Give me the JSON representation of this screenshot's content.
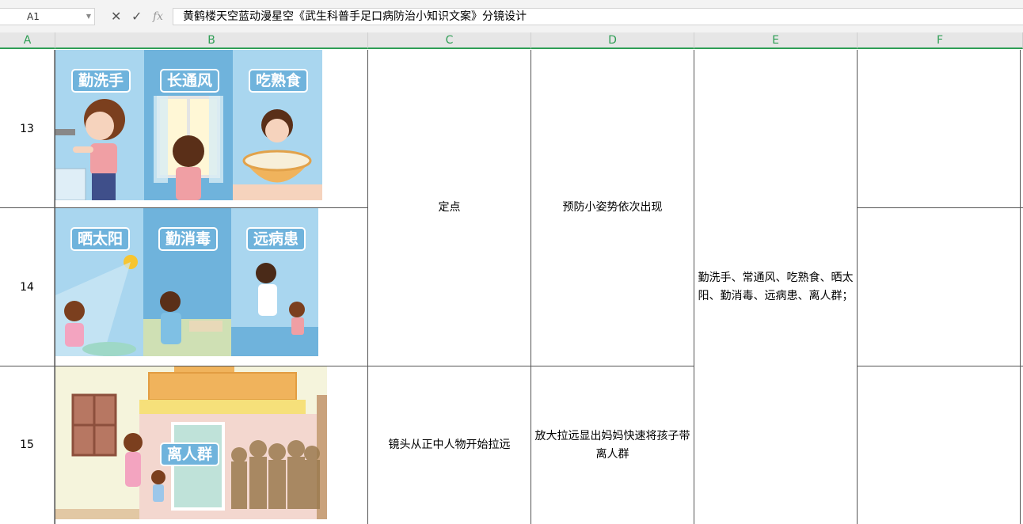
{
  "formula_bar": {
    "name_box": "A1",
    "cancel_icon": "close-icon",
    "confirm_icon": "check-icon",
    "fx_label": "fx",
    "content": "黄鹤楼天空蓝动漫星空《武生科普手足口病防治小知识文案》分镜设计"
  },
  "columns": [
    "A",
    "B",
    "C",
    "D",
    "E",
    "F"
  ],
  "rows": [
    {
      "number": "13",
      "image_tags": [
        "勤洗手",
        "长通风",
        "吃熟食"
      ]
    },
    {
      "number": "14",
      "image_tags": [
        "晒太阳",
        "勤消毒",
        "远病患"
      ]
    },
    {
      "number": "15",
      "image_tags": [
        "离人群"
      ]
    }
  ],
  "cells": {
    "c_13_14": "定点",
    "d_13_14": "预防小姿势依次出现",
    "e_13_15": "勤洗手、常通风、吃熟食、晒太阳、勤消毒、远病患、离人群；",
    "c_15": "镜头从正中人物开始拉远",
    "d_15": "放大拉远显出妈妈快速将孩子带离人群"
  },
  "colors": {
    "accent": "#2f9e55",
    "sky": "#a9d6ef",
    "tag": "#6fb3dc"
  }
}
